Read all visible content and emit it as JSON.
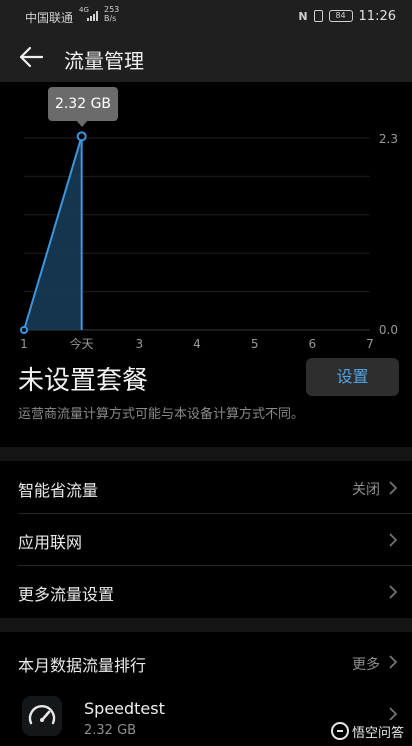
{
  "status_bar": {
    "carrier": "中国联通",
    "network": "4G",
    "speed_value": "253",
    "speed_unit": "B/s",
    "nfc": "N",
    "battery": "84",
    "time": "11:26"
  },
  "header": {
    "title": "流量管理"
  },
  "chart_data": {
    "type": "area",
    "x_labels": [
      "1",
      "今天",
      "3",
      "4",
      "5",
      "6",
      "7"
    ],
    "y_tick_labels": [
      "2.3",
      "0.0"
    ],
    "ylim": [
      0,
      2.3
    ],
    "points": [
      {
        "x": "1",
        "y": 0.0
      },
      {
        "x": "今天",
        "y": 2.32
      }
    ],
    "tooltip": "2.32 GB",
    "line_color": "#3b97e0",
    "fill_color": "#173a56",
    "grid": true
  },
  "plan": {
    "title": "未设置套餐",
    "button_label": "设置",
    "note": "运营商流量计算方式可能与本设备计算方式不同。"
  },
  "settings": [
    {
      "label": "智能省流量",
      "value": "关闭"
    },
    {
      "label": "应用联网",
      "value": ""
    },
    {
      "label": "更多流量设置",
      "value": ""
    }
  ],
  "ranking": {
    "title": "本月数据流量排行",
    "more_label": "更多",
    "apps": [
      {
        "name": "Speedtest",
        "usage": "2.32 GB",
        "icon": "speedometer-icon"
      }
    ]
  },
  "watermark": {
    "text": "悟空问答"
  }
}
